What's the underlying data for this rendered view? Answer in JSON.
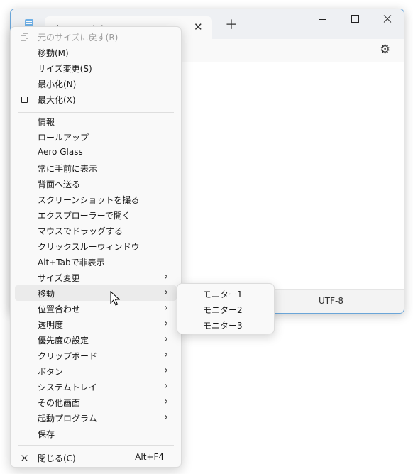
{
  "window": {
    "tab_title": "タイトルなし",
    "tab_close": "✕",
    "new_tab": "＋",
    "settings_icon": "gear-icon",
    "status_encoding": "UTF-8"
  },
  "system_menu": {
    "items": [
      {
        "label": "元のサイズに戻す(R)",
        "icon": "restore-icon",
        "disabled": true
      },
      {
        "label": "移動(M)"
      },
      {
        "label": "サイズ変更(S)"
      },
      {
        "label": "最小化(N)",
        "icon": "minimize-icon"
      },
      {
        "label": "最大化(X)",
        "icon": "maximize-icon"
      }
    ],
    "extra_items": [
      {
        "label": "情報"
      },
      {
        "label": "ロールアップ"
      },
      {
        "label": "Aero Glass"
      },
      {
        "label": "常に手前に表示"
      },
      {
        "label": "背面へ送る"
      },
      {
        "label": "スクリーンショットを撮る"
      },
      {
        "label": "エクスプローラーで開く"
      },
      {
        "label": "マウスでドラッグする"
      },
      {
        "label": "クリックスルーウィンドウ"
      },
      {
        "label": "Alt+Tabで非表示"
      },
      {
        "label": "サイズ変更",
        "submenu": true
      },
      {
        "label": "移動",
        "submenu": true,
        "highlighted": true
      },
      {
        "label": "位置合わせ",
        "submenu": true
      },
      {
        "label": "透明度",
        "submenu": true
      },
      {
        "label": "優先度の設定",
        "submenu": true
      },
      {
        "label": "クリップボード",
        "submenu": true
      },
      {
        "label": "ボタン",
        "submenu": true
      },
      {
        "label": "システムトレイ",
        "submenu": true
      },
      {
        "label": "その他画面",
        "submenu": true
      },
      {
        "label": "起動プログラム",
        "submenu": true
      },
      {
        "label": "保存"
      }
    ],
    "close_item": {
      "label": "閉じる(C)",
      "shortcut": "Alt+F4",
      "icon": "close-icon"
    },
    "submenu_arrow": "›"
  },
  "move_submenu": {
    "items": [
      "モニター1",
      "モニター2",
      "モニター3"
    ]
  }
}
